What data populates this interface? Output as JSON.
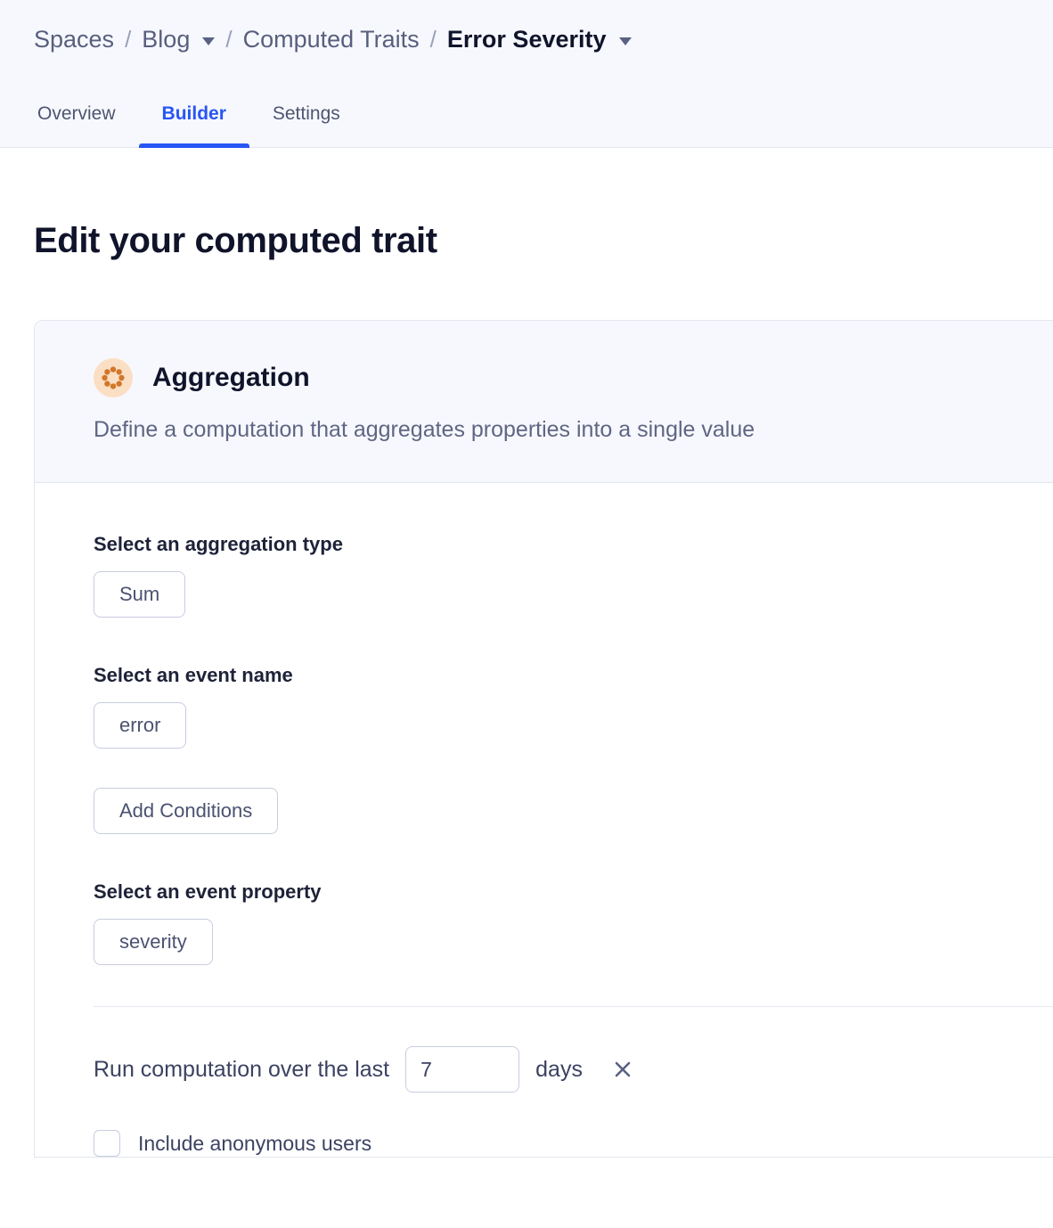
{
  "breadcrumb": {
    "items": [
      {
        "label": "Spaces",
        "current": false,
        "has_caret": false
      },
      {
        "label": "Blog",
        "current": false,
        "has_caret": true
      },
      {
        "label": "Computed Traits",
        "current": false,
        "has_caret": false
      },
      {
        "label": "Error Severity",
        "current": true,
        "has_caret": true
      }
    ],
    "separator": "/"
  },
  "tabs": [
    {
      "label": "Overview",
      "active": false
    },
    {
      "label": "Builder",
      "active": true
    },
    {
      "label": "Settings",
      "active": false
    }
  ],
  "page": {
    "title": "Edit your computed trait"
  },
  "card": {
    "icon_name": "aggregation-flower-icon",
    "title": "Aggregation",
    "description": "Define a computation that aggregates properties into a single value",
    "accent_color": "#d2762a",
    "badge_bg": "#fbdfc4",
    "fields": {
      "aggregation_type": {
        "label": "Select an aggregation type",
        "value": "Sum"
      },
      "event_name": {
        "label": "Select an event name",
        "value": "error"
      },
      "add_conditions": {
        "label": "Add Conditions"
      },
      "event_property": {
        "label": "Select an event property",
        "value": "severity"
      }
    },
    "run_computation": {
      "prefix": "Run computation over the last",
      "value": "7",
      "placeholder": "7",
      "unit": "days",
      "remove_icon": "✕"
    },
    "include_anonymous": {
      "label": "Include anonymous users",
      "checked": false
    }
  },
  "colors": {
    "accent_blue": "#2756f5",
    "topbar_bg": "#f7f8fd",
    "border": "#e3e6f0",
    "text_dark": "#10142b",
    "text_muted": "#5f6684"
  }
}
